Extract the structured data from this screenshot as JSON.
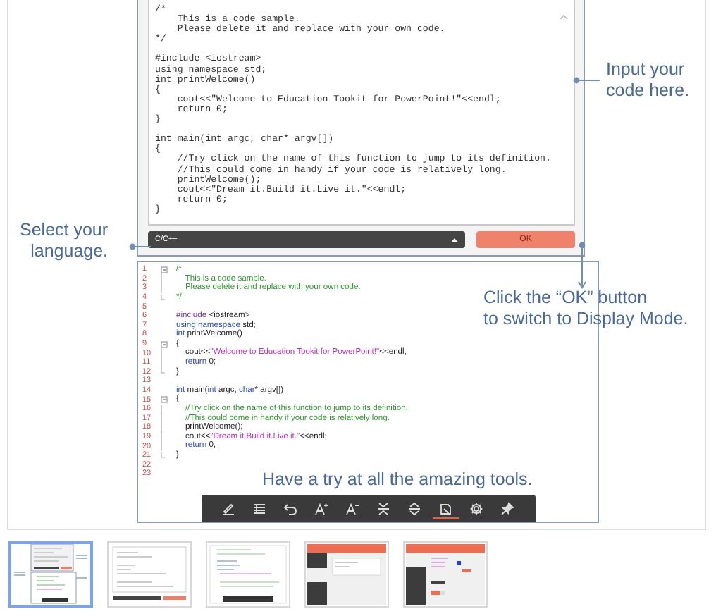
{
  "editor": {
    "code": "/*\n    This is a code sample.\n    Please delete it and replace with your own code.\n*/\n\n#include <iostream>\nusing namespace std;\nint printWelcome()\n{\n    cout<<\"Welcome to Education Tookit for PowerPoint!\"<<endl;\n    return 0;\n}\n\nint main(int argc, char* argv[])\n{\n    //Try click on the name of this function to jump to its definition.\n    //This could come in handy if your code is relatively long.\n    printWelcome();\n    cout<<\"Dream it.Build it.Live it.\"<<endl;\n    return 0;\n}"
  },
  "language_select": {
    "value": "C/C++"
  },
  "ok_button": "OK",
  "display": {
    "lines": [
      {
        "number": "1",
        "kind": "fold-start",
        "tokens": [
          {
            "kind": "comment",
            "text": "/*"
          }
        ]
      },
      {
        "number": "2",
        "kind": "fold-body",
        "tokens": [
          {
            "kind": "comment",
            "text": "    This is a code sample."
          }
        ]
      },
      {
        "number": "3",
        "kind": "fold-body",
        "tokens": [
          {
            "kind": "comment",
            "text": "    Please delete it and replace with your own code."
          }
        ]
      },
      {
        "number": "4",
        "kind": "fold-end",
        "tokens": [
          {
            "kind": "comment",
            "text": "*/"
          }
        ]
      },
      {
        "number": "5"
      },
      {
        "number": "6",
        "tokens": [
          {
            "kind": "preproc",
            "text": "#include"
          },
          {
            "kind": "plain",
            "text": " <iostream>"
          }
        ]
      },
      {
        "number": "7",
        "tokens": [
          {
            "kind": "keyword",
            "text": "using namespace"
          },
          {
            "kind": "plain",
            "text": " std;"
          }
        ]
      },
      {
        "number": "8",
        "tokens": [
          {
            "kind": "keyword",
            "text": "int"
          },
          {
            "kind": "plain",
            "text": " printWelcome()"
          }
        ]
      },
      {
        "number": "9",
        "kind": "fold-start",
        "tokens": [
          {
            "kind": "plain",
            "text": "{"
          }
        ]
      },
      {
        "number": "10",
        "kind": "fold-body",
        "tokens": [
          {
            "kind": "plain",
            "text": "    cout<<"
          },
          {
            "kind": "string",
            "text": "\"Welcome to Education Tookit for PowerPoint!\""
          },
          {
            "kind": "plain",
            "text": "<<endl;"
          }
        ]
      },
      {
        "number": "11",
        "kind": "fold-body",
        "tokens": [
          {
            "kind": "keyword",
            "text": "    return"
          },
          {
            "kind": "plain",
            "text": " 0;"
          }
        ]
      },
      {
        "number": "12",
        "kind": "fold-end",
        "tokens": [
          {
            "kind": "plain",
            "text": "}"
          }
        ]
      },
      {
        "number": "13"
      },
      {
        "number": "14",
        "tokens": [
          {
            "kind": "keyword",
            "text": "int"
          },
          {
            "kind": "plain",
            "text": " main("
          },
          {
            "kind": "keyword",
            "text": "int"
          },
          {
            "kind": "plain",
            "text": " argc, "
          },
          {
            "kind": "keyword",
            "text": "char"
          },
          {
            "kind": "plain",
            "text": "* argv[])"
          }
        ]
      },
      {
        "number": "15",
        "kind": "fold-start",
        "tokens": [
          {
            "kind": "plain",
            "text": "{"
          }
        ]
      },
      {
        "number": "16",
        "kind": "fold-body",
        "tokens": [
          {
            "kind": "comment",
            "text": "    //Try click on the name of this function to jump to its definition."
          }
        ]
      },
      {
        "number": "17",
        "kind": "fold-body",
        "tokens": [
          {
            "kind": "comment",
            "text": "    //This could come in handy if your code is relatively long."
          }
        ]
      },
      {
        "number": "18",
        "kind": "fold-body",
        "tokens": [
          {
            "kind": "plain",
            "text": "    printWelcome();"
          }
        ]
      },
      {
        "number": "19",
        "kind": "fold-body",
        "tokens": [
          {
            "kind": "plain",
            "text": "    cout<<"
          },
          {
            "kind": "string",
            "text": "\"Dream it.Build it.Live it.\""
          },
          {
            "kind": "plain",
            "text": "<<endl;"
          }
        ]
      },
      {
        "number": "20",
        "kind": "fold-body",
        "tokens": [
          {
            "kind": "keyword",
            "text": "    return"
          },
          {
            "kind": "plain",
            "text": " 0;"
          }
        ]
      },
      {
        "number": "21",
        "kind": "fold-end",
        "tokens": [
          {
            "kind": "plain",
            "text": "}"
          }
        ]
      },
      {
        "number": "22"
      },
      {
        "number": "23"
      }
    ]
  },
  "toolbar": [
    {
      "kind": "pen",
      "selected": false
    },
    {
      "kind": "list",
      "selected": false
    },
    {
      "kind": "undo",
      "selected": false
    },
    {
      "kind": "font-up",
      "selected": false
    },
    {
      "kind": "font-down",
      "selected": false
    },
    {
      "kind": "collapse",
      "selected": false
    },
    {
      "kind": "expand",
      "selected": false
    },
    {
      "kind": "eraser",
      "selected": true
    },
    {
      "kind": "settings",
      "selected": false
    },
    {
      "kind": "pin",
      "selected": false
    }
  ],
  "annotations": [
    {
      "kind": "input",
      "text": "Input your\ncode here."
    },
    {
      "kind": "language",
      "text": "Select your\nlanguage."
    },
    {
      "kind": "ok",
      "text": "Click the “OK” button\nto switch to Display Mode."
    },
    {
      "kind": "tools",
      "text": "Have a try at all the amazing tools."
    }
  ],
  "thumbnails": [
    {
      "kind": "overview",
      "selected": true
    },
    {
      "kind": "input",
      "selected": false
    },
    {
      "kind": "display",
      "selected": false
    },
    {
      "kind": "menu",
      "selected": false
    },
    {
      "kind": "settings",
      "selected": false
    }
  ]
}
